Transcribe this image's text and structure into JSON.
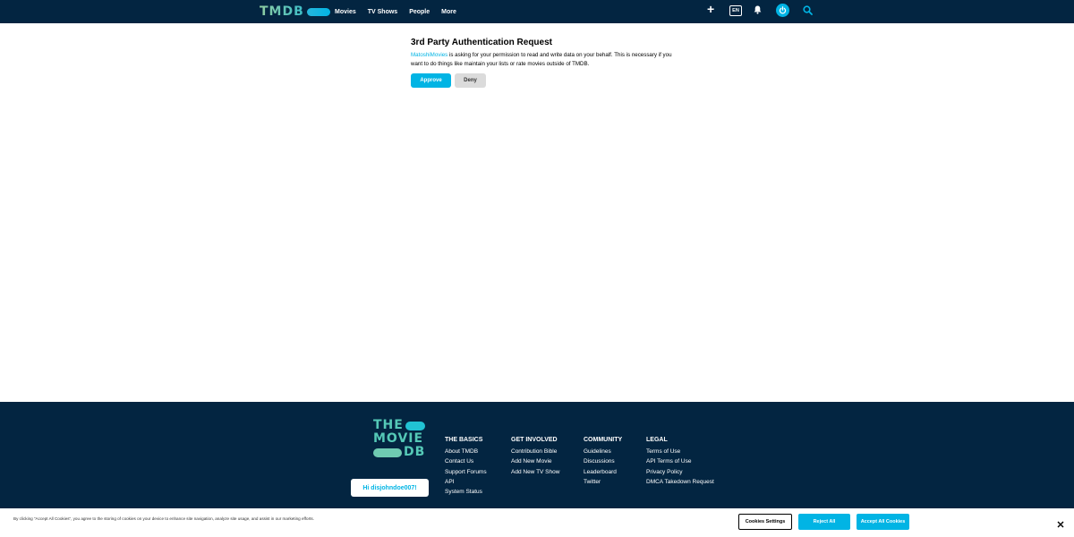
{
  "header": {
    "logo_text": "TMDB",
    "nav": [
      "Movies",
      "TV Shows",
      "People",
      "More"
    ],
    "language": "EN",
    "icons": [
      "plus-icon",
      "bell-icon",
      "power-icon",
      "search-icon"
    ]
  },
  "auth": {
    "title": "3rd Party Authentication Request",
    "app_name": "MatoshiMovies",
    "text_after_app": " is asking for your permission to read and write data on your behalf. This is necessary if you want to do things like maintain your lists or rate movies outside of TMDB.",
    "approve_label": "Approve",
    "deny_label": "Deny"
  },
  "footer": {
    "logo_lines": [
      "THE",
      "MOVIE",
      "DB"
    ],
    "greeting": "Hi disjohndoe007!",
    "columns": [
      {
        "heading": "THE BASICS",
        "links": [
          "About TMDB",
          "Contact Us",
          "Support Forums",
          "API",
          "System Status"
        ]
      },
      {
        "heading": "GET INVOLVED",
        "links": [
          "Contribution Bible",
          "Add New Movie",
          "Add New TV Show"
        ]
      },
      {
        "heading": "COMMUNITY",
        "links": [
          "Guidelines",
          "Discussions",
          "Leaderboard",
          "Twitter"
        ]
      },
      {
        "heading": "LEGAL",
        "links": [
          "Terms of Use",
          "API Terms of Use",
          "Privacy Policy",
          "DMCA Takedown Request"
        ]
      }
    ]
  },
  "cookie": {
    "text": "By clicking “Accept All Cookies”, you agree to the storing of cookies on your device to enhance site navigation, analyze site usage, and assist in our marketing efforts.",
    "settings_label": "Cookies Settings",
    "reject_label": "Reject All",
    "accept_label": "Accept All Cookies"
  },
  "colors": {
    "navy": "#032541",
    "accent": "#01b4e4"
  }
}
